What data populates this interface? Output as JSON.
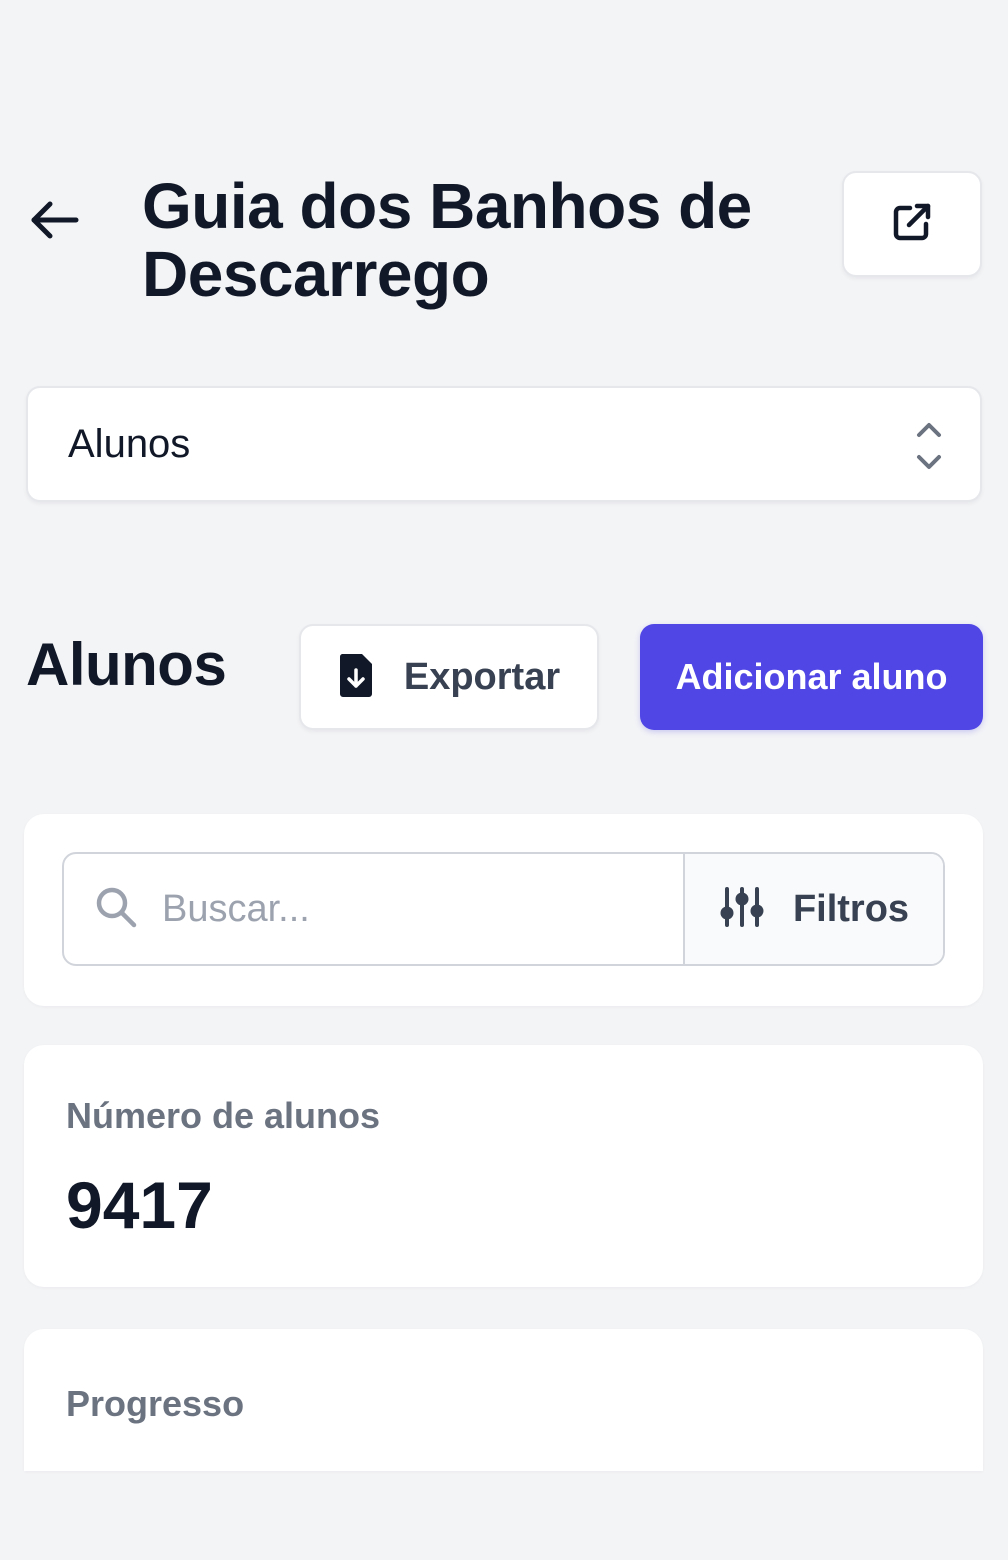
{
  "header": {
    "title": "Guia dos Banhos de Descarrego",
    "back_icon": "arrow-left-icon",
    "external_icon": "external-link-icon"
  },
  "selector": {
    "value": "Alunos",
    "icon": "chevron-up-down-icon"
  },
  "section": {
    "title": "Alunos",
    "export_label": "Exportar",
    "export_icon": "file-download-icon",
    "add_label": "Adicionar aluno"
  },
  "search": {
    "placeholder": "Buscar...",
    "value": "",
    "icon": "search-icon",
    "filter_label": "Filtros",
    "filter_icon": "sliders-icon"
  },
  "stats": {
    "students_label": "Número de alunos",
    "students_value": "9417"
  },
  "progress": {
    "label": "Progresso"
  },
  "colors": {
    "primary": "#4f46e5",
    "background": "#f3f4f6",
    "heading": "#111827",
    "muted": "#6b7280"
  }
}
